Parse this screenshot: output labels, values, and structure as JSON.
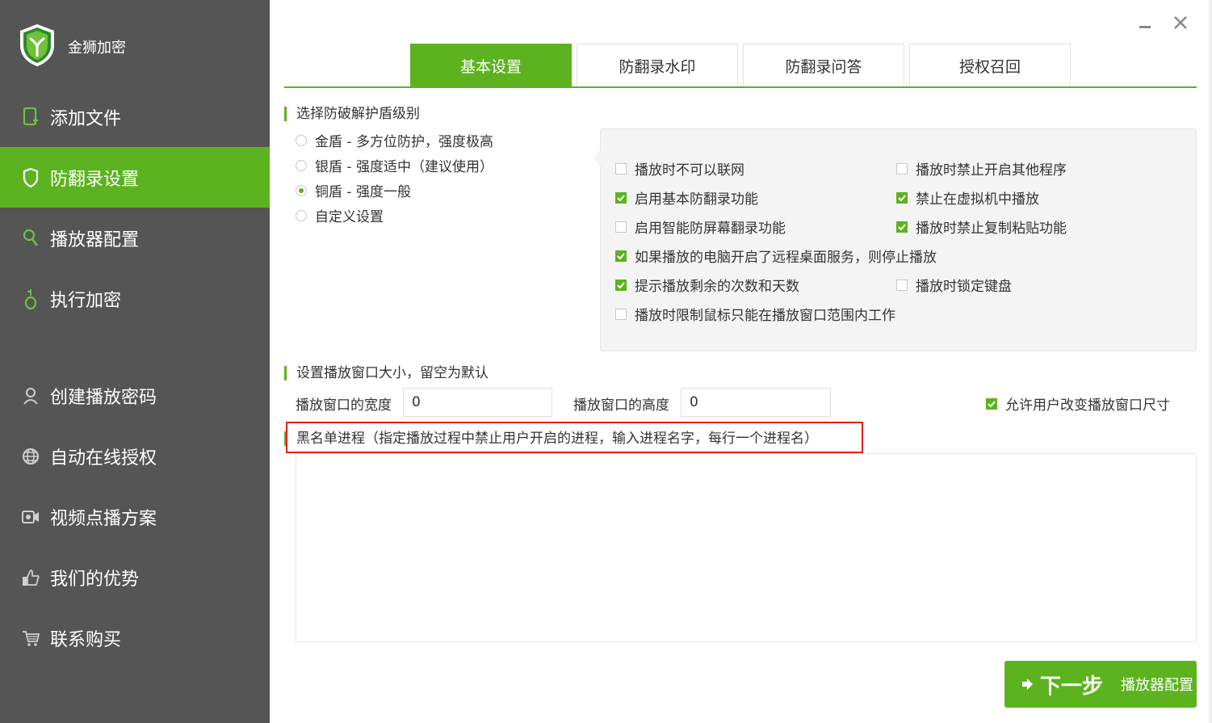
{
  "app": {
    "name": "金狮加密"
  },
  "sidebar": {
    "items": [
      {
        "label": "添加文件",
        "icon": "add-file-icon"
      },
      {
        "label": "防翻录设置",
        "icon": "shield-icon",
        "active": true
      },
      {
        "label": "播放器配置",
        "icon": "search-icon"
      },
      {
        "label": "执行加密",
        "icon": "lock-icon"
      }
    ],
    "lower_items": [
      {
        "label": "创建播放密码",
        "icon": "user-icon"
      },
      {
        "label": "自动在线授权",
        "icon": "globe-icon"
      },
      {
        "label": "视频点播方案",
        "icon": "video-icon"
      },
      {
        "label": "我们的优势",
        "icon": "thumbs-up-icon"
      },
      {
        "label": "联系购买",
        "icon": "cart-icon"
      }
    ]
  },
  "tabs": [
    {
      "label": "基本设置",
      "active": true
    },
    {
      "label": "防翻录水印"
    },
    {
      "label": "防翻录问答"
    },
    {
      "label": "授权召回"
    }
  ],
  "shield_level": {
    "title": "选择防破解护盾级别",
    "options": [
      {
        "label": "金盾 - 多方位防护，强度极高",
        "checked": false
      },
      {
        "label": "银盾 - 强度适中（建议使用）",
        "checked": false
      },
      {
        "label": "铜盾 - 强度一般",
        "checked": true
      },
      {
        "label": "自定义设置",
        "checked": false
      }
    ]
  },
  "options": {
    "no_network": {
      "label": "播放时不可以联网",
      "checked": false
    },
    "block_other_programs": {
      "label": "播放时禁止开启其他程序",
      "checked": false
    },
    "basic_anti_record": {
      "label": "启用基本防翻录功能",
      "checked": true
    },
    "block_vm": {
      "label": "禁止在虚拟机中播放",
      "checked": true
    },
    "smart_anti_screen": {
      "label": "启用智能防屏幕翻录功能",
      "checked": false
    },
    "block_copy_paste": {
      "label": "播放时禁止复制粘贴功能",
      "checked": true
    },
    "stop_remote_desktop": {
      "label": "如果播放的电脑开启了远程桌面服务，则停止播放",
      "checked": true
    },
    "show_remaining": {
      "label": "提示播放剩余的次数和天数",
      "checked": true
    },
    "lock_keyboard": {
      "label": "播放时锁定键盘",
      "checked": false
    },
    "limit_mouse": {
      "label": "播放时限制鼠标只能在播放窗口范围内工作",
      "checked": false
    }
  },
  "window_size": {
    "title": "设置播放窗口大小，留空为默认",
    "width_label": "播放窗口的宽度",
    "width_value": "0",
    "height_label": "播放窗口的高度",
    "height_value": "0",
    "allow_resize": {
      "label": "允许用户改变播放窗口尺寸",
      "checked": true
    }
  },
  "blacklist": {
    "title": "黑名单进程（指定播放过程中禁止用户开启的进程，输入进程名字，每行一个进程名）",
    "value": ""
  },
  "next_button": {
    "label": "下一步",
    "sub_label": "播放器配置"
  },
  "colors": {
    "accent": "#5cb31f",
    "sidebar": "#555555",
    "highlight": "#e02020"
  }
}
